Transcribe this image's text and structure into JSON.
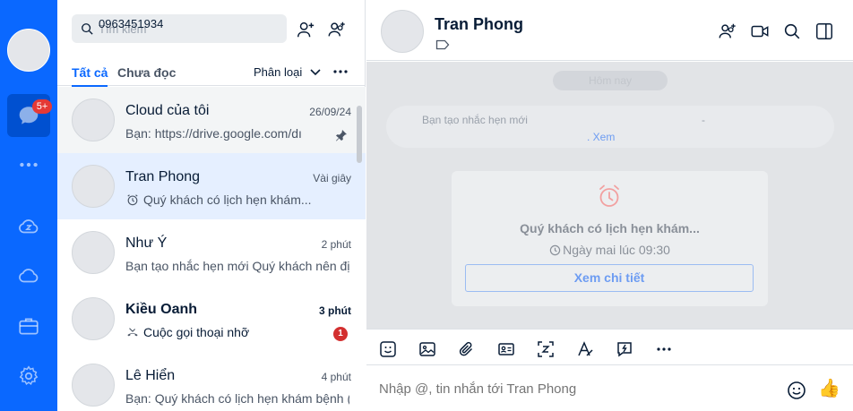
{
  "rail": {
    "badge": "5+",
    "accent": "#0a68ff"
  },
  "search": {
    "value": "0963451934",
    "placeholder": "Tìm kiếm"
  },
  "filters": {
    "all": "Tất cả",
    "unread": "Chưa đọc",
    "classify": "Phân loại"
  },
  "conversations": [
    {
      "name": "Cloud của tôi",
      "time": "26/09/24",
      "preview": "Bạn:  https://drive.google.com/dı",
      "pinned": true
    },
    {
      "name": "Tran Phong",
      "time": "Vài giây",
      "preview": "Quý khách có lịch hẹn khám...",
      "selected": true
    },
    {
      "name": "Như Ý",
      "time": "2 phút",
      "preview": "Bạn tạo nhắc hẹn mới Quý khách nên đị"
    },
    {
      "name": "Kiều Oanh",
      "time": "3 phút",
      "preview": "Cuộc gọi thoại nhỡ",
      "unread": "1"
    },
    {
      "name": "Lê Hiển",
      "time": "4 phút",
      "preview": "Bạn: Quý khách có lịch hẹn khám bệnh ("
    }
  ],
  "chat": {
    "name": "Tran Phong",
    "date_pill": "Hôm nay",
    "system_message": "Bạn tạo nhắc hẹn mới",
    "system_dash": "-",
    "system_link": ". Xem",
    "card_title": "Quý khách có lịch hẹn khám...",
    "card_time": "Ngày mai lúc 09:30",
    "card_button": "Xem chi tiết",
    "input_placeholder": "Nhập @, tin nhắn tới Tran Phong"
  }
}
